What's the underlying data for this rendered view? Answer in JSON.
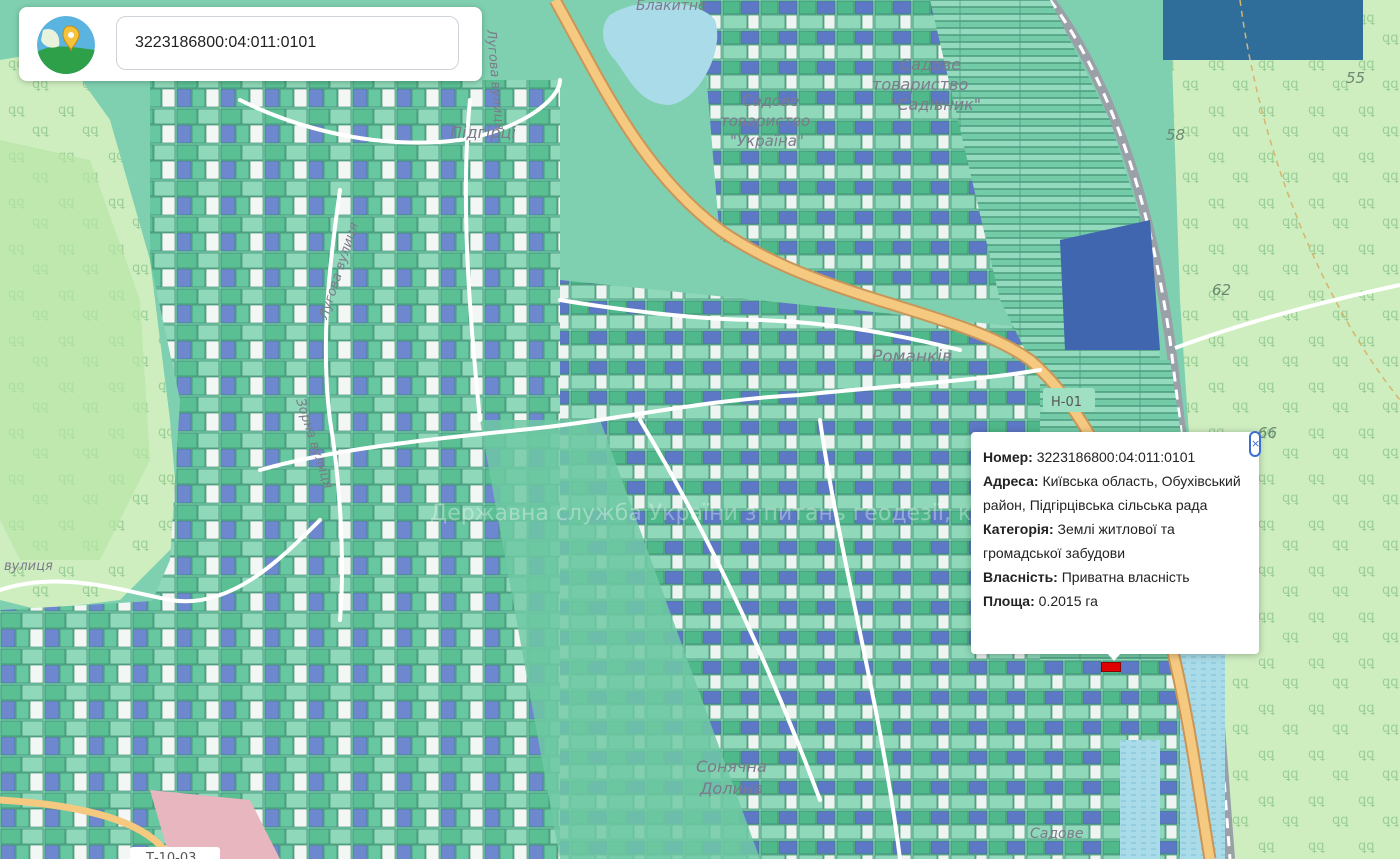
{
  "search": {
    "value": "3223186800:04:011:0101"
  },
  "popup": {
    "number_label": "Номер:",
    "number_value": "3223186800:04:011:0101",
    "address_label": "Адреса:",
    "address_value": "Київська область, Обухівський район, Підгірцівська сільська рада",
    "category_label": "Категорія:",
    "category_value": "Землі житлової та громадської забудови",
    "ownership_label": "Власність:",
    "ownership_value": "Приватна власність",
    "area_label": "Площа:",
    "area_value": "0.2015 га",
    "close_glyph": "×"
  },
  "map": {
    "labels": {
      "lake": "Блакитне",
      "garden1_line1": "Садове",
      "garden1_line2": "товариство",
      "garden1_line3": "\"Садівник\"",
      "garden2_line1": "Садове",
      "garden2_line2": "товариство",
      "garden2_line3": "\"Україна\"",
      "village_top": "Підгірці",
      "village_mid": "Романків",
      "village_bottom_line1": "Сонячна",
      "village_bottom_line2": "Долина",
      "street_lugova": "Лугова вулиця",
      "street_zorna": "Зорна вулиця",
      "street_vulytsia": "вулиця",
      "street_top": "Лугова вулиця",
      "watermark": "Державна служба України з питань геодезії, картографії та кадастру",
      "bottom_right": "Садове"
    },
    "road_labels": {
      "highway": "Н-01",
      "bottom_left": "Т-10-03"
    },
    "elevations": [
      "55",
      "58",
      "62",
      "66"
    ],
    "colors": {
      "parcel_green": "#6fc9a3",
      "parcel_blue": "#5b75c4",
      "forest": "#cfeec0",
      "highway": "#f2c57c",
      "water": "#a9dbe8"
    }
  }
}
